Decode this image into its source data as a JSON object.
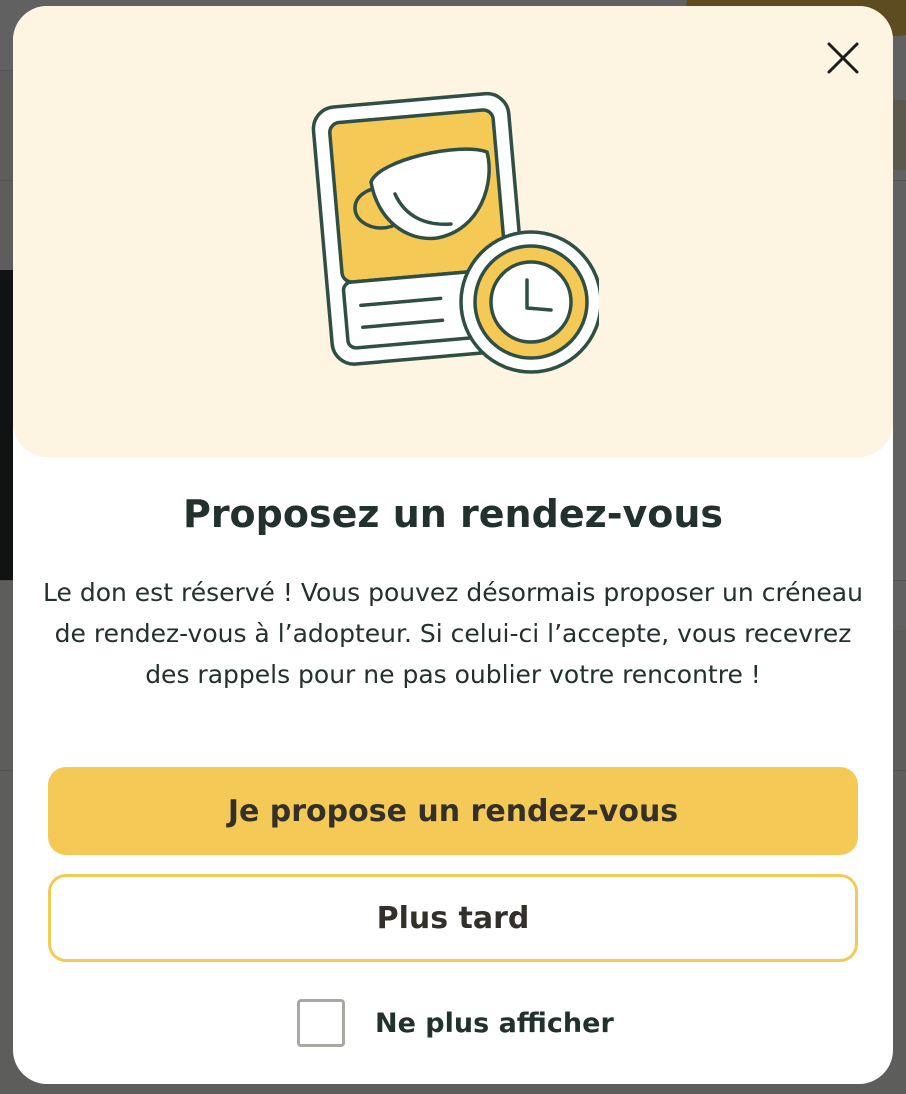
{
  "modal": {
    "close_icon": "close-icon",
    "illustration_icon": "coffee-cup-clock-icon",
    "title": "Proposez un rendez-vous",
    "description": "Le don est réservé ! Vous pouvez désormais proposer un créneau de rendez-vous à l’adopteur. Si celui-ci l’accepte, vous recevrez des rappels pour ne pas oublier votre rencontre !",
    "primary_button": "Je propose un rendez-vous",
    "secondary_button": "Plus tard",
    "checkbox_label": "Ne plus afficher",
    "checkbox_checked": false
  },
  "colors": {
    "accent": "#f5c956",
    "hero_background": "#fdf4e1",
    "text": "#22302e",
    "outline": "#2f4f45"
  }
}
